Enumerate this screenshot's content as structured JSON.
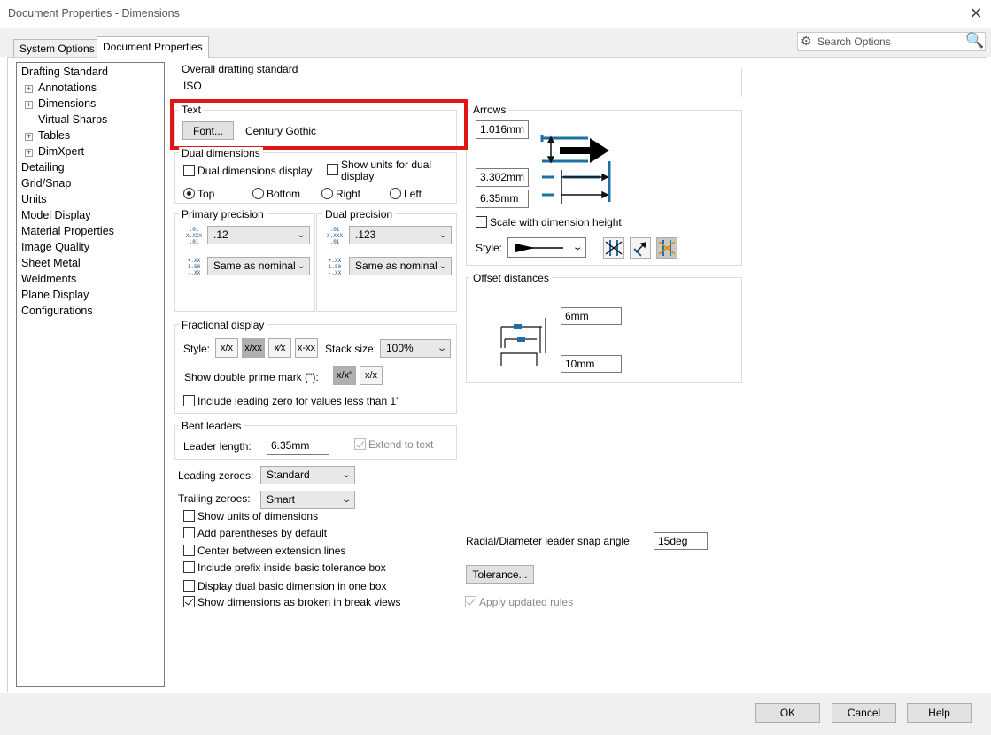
{
  "window": {
    "title": "Document Properties - Dimensions",
    "close": "✕"
  },
  "tabs": {
    "system": "System Options",
    "document": "Document Properties"
  },
  "search": {
    "placeholder": "Search Options",
    "gear": "⚙",
    "mag": "🔍"
  },
  "tree": [
    {
      "label": "Drafting Standard",
      "level": 1,
      "expandable": false
    },
    {
      "label": "Annotations",
      "level": 2,
      "expandable": true
    },
    {
      "label": "Dimensions",
      "level": 2,
      "expandable": true
    },
    {
      "label": "Virtual Sharps",
      "level": 2,
      "expandable": false
    },
    {
      "label": "Tables",
      "level": 2,
      "expandable": true
    },
    {
      "label": "DimXpert",
      "level": 2,
      "expandable": true
    },
    {
      "label": "Detailing",
      "level": 1,
      "expandable": false
    },
    {
      "label": "Grid/Snap",
      "level": 1,
      "expandable": false
    },
    {
      "label": "Units",
      "level": 1,
      "expandable": false
    },
    {
      "label": "Model Display",
      "level": 1,
      "expandable": false
    },
    {
      "label": "Material Properties",
      "level": 1,
      "expandable": false
    },
    {
      "label": "Image Quality",
      "level": 1,
      "expandable": false
    },
    {
      "label": "Sheet Metal",
      "level": 1,
      "expandable": false
    },
    {
      "label": "Weldments",
      "level": 1,
      "expandable": false
    },
    {
      "label": "Plane Display",
      "level": 1,
      "expandable": false
    },
    {
      "label": "Configurations",
      "level": 1,
      "expandable": false
    }
  ],
  "overall": {
    "label": "Overall drafting standard",
    "value": "ISO"
  },
  "text": {
    "label": "Text",
    "font_button": "Font...",
    "font_name": "Century Gothic"
  },
  "dual": {
    "label": "Dual dimensions",
    "dual_display": "Dual dimensions display",
    "show_units": "Show units for dual",
    "show_units2": "display",
    "top": "Top",
    "bottom": "Bottom",
    "right": "Right",
    "left": "Left"
  },
  "primary": {
    "label": "Primary precision",
    "value": ".12",
    "tol": "Same as nominal",
    "ic1": ".01 X.XXX .01",
    "ic2": "+.XX 1.50 -.XX"
  },
  "dualprec": {
    "label": "Dual precision",
    "value": ".123",
    "tol": "Same as nominal"
  },
  "fractional": {
    "label": "Fractional display",
    "style": "Style:",
    "stack_size_label": "Stack size:",
    "stack_size": "100%",
    "s1": "x/x",
    "s2": "x/xx",
    "s3": "x⁄x",
    "s4": "x-xx",
    "double_prime": "Show double prime mark (\"):",
    "dp1": "x/x\"",
    "dp2": "x/x",
    "leading_zero": "Include leading zero for values less than 1\""
  },
  "bent": {
    "label": "Bent leaders",
    "length_label": "Leader length:",
    "length": "6.35mm",
    "extend": "Extend to text"
  },
  "zeroes": {
    "leading_label": "Leading zeroes:",
    "leading": "Standard",
    "trailing_label": "Trailing zeroes:",
    "trailing": "Smart"
  },
  "options": [
    {
      "label": "Show units of dimensions",
      "checked": false
    },
    {
      "label": "Add parentheses by default",
      "checked": false
    },
    {
      "label": "Center between extension lines",
      "checked": false
    },
    {
      "label": "Include prefix inside basic tolerance box",
      "checked": false
    },
    {
      "label": "Display dual basic dimension in one box",
      "checked": false
    },
    {
      "label": "Show dimensions as broken in break views",
      "checked": true
    }
  ],
  "arrows": {
    "label": "Arrows",
    "v1": "1.016mm",
    "v2": "3.302mm",
    "v3": "6.35mm",
    "scale": "Scale with dimension height",
    "style": "Style:"
  },
  "offset": {
    "label": "Offset distances",
    "v1": "6mm",
    "v2": "10mm"
  },
  "radial": {
    "label": "Radial/Diameter leader snap angle:",
    "value": "15deg"
  },
  "tolerance_button": "Tolerance...",
  "apply_rules": "Apply updated rules",
  "buttons": {
    "ok": "OK",
    "cancel": "Cancel",
    "help": "Help"
  },
  "colors": {
    "accent_blue": "#1d6fa5",
    "highlight_red": "#e01616"
  }
}
